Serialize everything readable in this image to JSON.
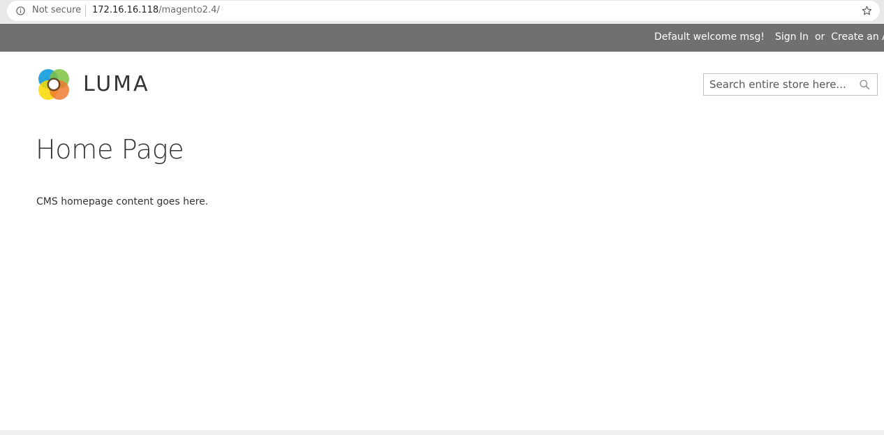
{
  "browser": {
    "security_label": "Not secure",
    "url_host": "172.16.16.118",
    "url_path": "/magento2.4/",
    "info_icon": "info-icon",
    "bookmark_icon": "star-icon"
  },
  "panel_header": {
    "welcome": "Default welcome msg!",
    "sign_in": "Sign In",
    "or": "or",
    "create_account": "Create an Account"
  },
  "logo": {
    "text": "LUMA",
    "icon": "luma-logo-icon"
  },
  "search": {
    "placeholder": "Search entire store here...",
    "value": "",
    "icon": "search-icon"
  },
  "main": {
    "title": "Home Page",
    "content": "CMS homepage content goes here."
  },
  "colors": {
    "header_bg": "#6e716e",
    "text": "#333333",
    "logo_blue": "#1ba0dd",
    "logo_green": "#7fc241",
    "logo_yellow": "#fcd800",
    "logo_orange": "#ee7a33"
  }
}
